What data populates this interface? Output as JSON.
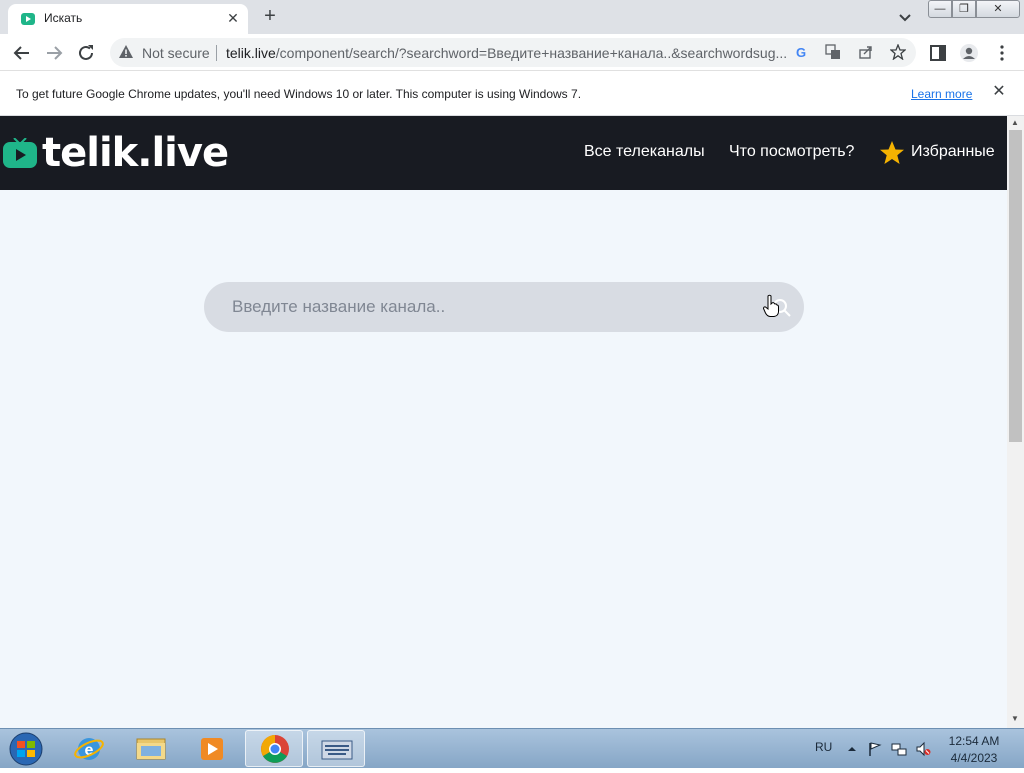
{
  "browser": {
    "tab": {
      "title": "Искать",
      "close_glyph": "✕"
    },
    "new_tab_glyph": "+",
    "window_controls": {
      "minimize": "—",
      "restore": "❐",
      "close": "✕"
    },
    "toolbar": {
      "not_secure_label": "Not secure",
      "url_host": "telik.live",
      "url_path": "/component/search/?searchword=Введите+название+канала..&searchwordsug..."
    },
    "infobar": {
      "message": "To get future Google Chrome updates, you'll need Windows 10 or later. This computer is using Windows 7.",
      "learn_more": "Learn more",
      "close_glyph": "✕"
    }
  },
  "site": {
    "logo_text": "telik.live",
    "nav": {
      "all_channels": "Все телеканалы",
      "what_to_watch": "Что посмотреть?",
      "favorites": "Избранные"
    },
    "search": {
      "placeholder": "Введите название канала.."
    },
    "colors": {
      "header_bg": "#181b22",
      "page_bg": "#f2f7fc",
      "accent_green": "#1fb589",
      "star": "#f5b301"
    }
  },
  "taskbar": {
    "language": "RU",
    "time": "12:54 AM",
    "date": "4/4/2023"
  }
}
